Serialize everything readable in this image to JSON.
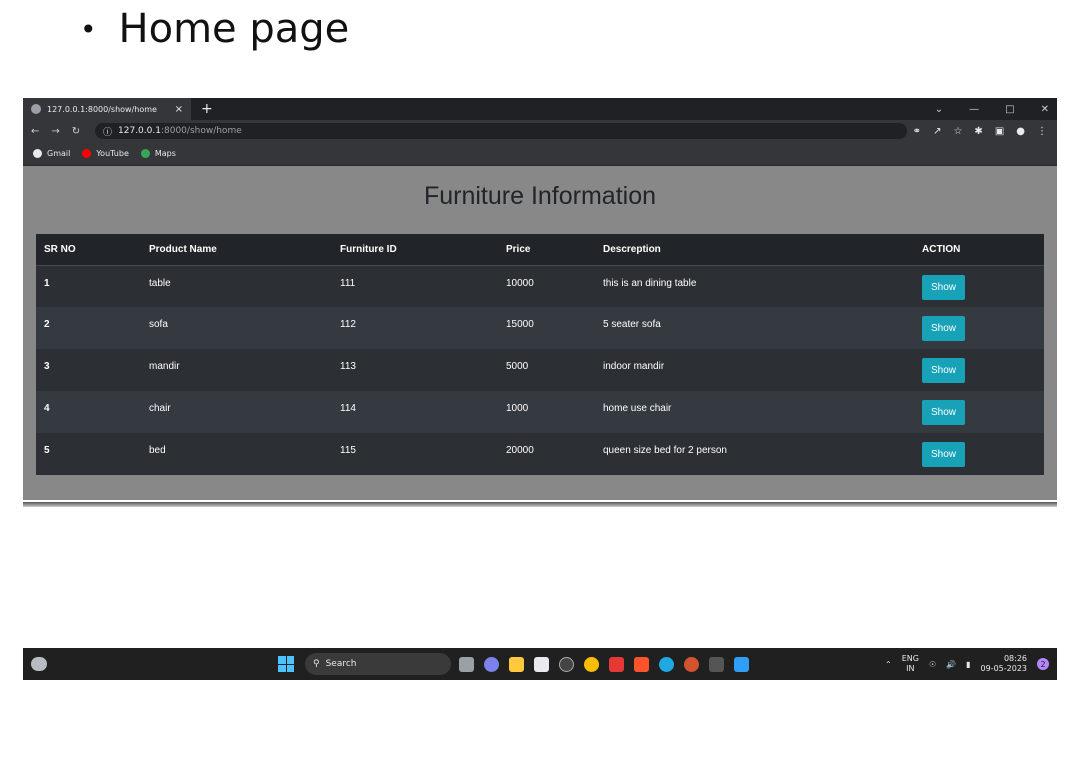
{
  "slide": {
    "bullet": "•",
    "title": "Home page"
  },
  "browser": {
    "tab_title": "127.0.0.1:8000/show/home",
    "tab_close": "×",
    "new_tab": "+",
    "url_host": "127.0.0.1",
    "url_path": ":8000/show/home",
    "bookmarks": [
      "Gmail",
      "YouTube",
      "Maps"
    ]
  },
  "page": {
    "heading": "Furniture Information",
    "columns": [
      "SR NO",
      "Product Name",
      "Furniture ID",
      "Price",
      "Descreption",
      "ACTION"
    ],
    "rows": [
      {
        "sr": "1",
        "name": "table",
        "id": "111",
        "price": "10000",
        "desc": "this is an dining table",
        "action": "Show"
      },
      {
        "sr": "2",
        "name": "sofa",
        "id": "112",
        "price": "15000",
        "desc": "5 seater sofa",
        "action": "Show"
      },
      {
        "sr": "3",
        "name": "mandir",
        "id": "113",
        "price": "5000",
        "desc": "indoor mandir",
        "action": "Show"
      },
      {
        "sr": "4",
        "name": "chair",
        "id": "114",
        "price": "1000",
        "desc": "home use chair",
        "action": "Show"
      },
      {
        "sr": "5",
        "name": "bed",
        "id": "115",
        "price": "20000",
        "desc": "queen size bed for 2 person",
        "action": "Show"
      }
    ]
  },
  "taskbar": {
    "search_label": "Search",
    "lang_top": "ENG",
    "lang_bottom": "IN",
    "time": "08:26",
    "date": "09-05-2023",
    "notifications": "2"
  },
  "colors": {
    "accent": "#17a2b8",
    "page_bg": "#888888",
    "table_dark": "#212529"
  }
}
